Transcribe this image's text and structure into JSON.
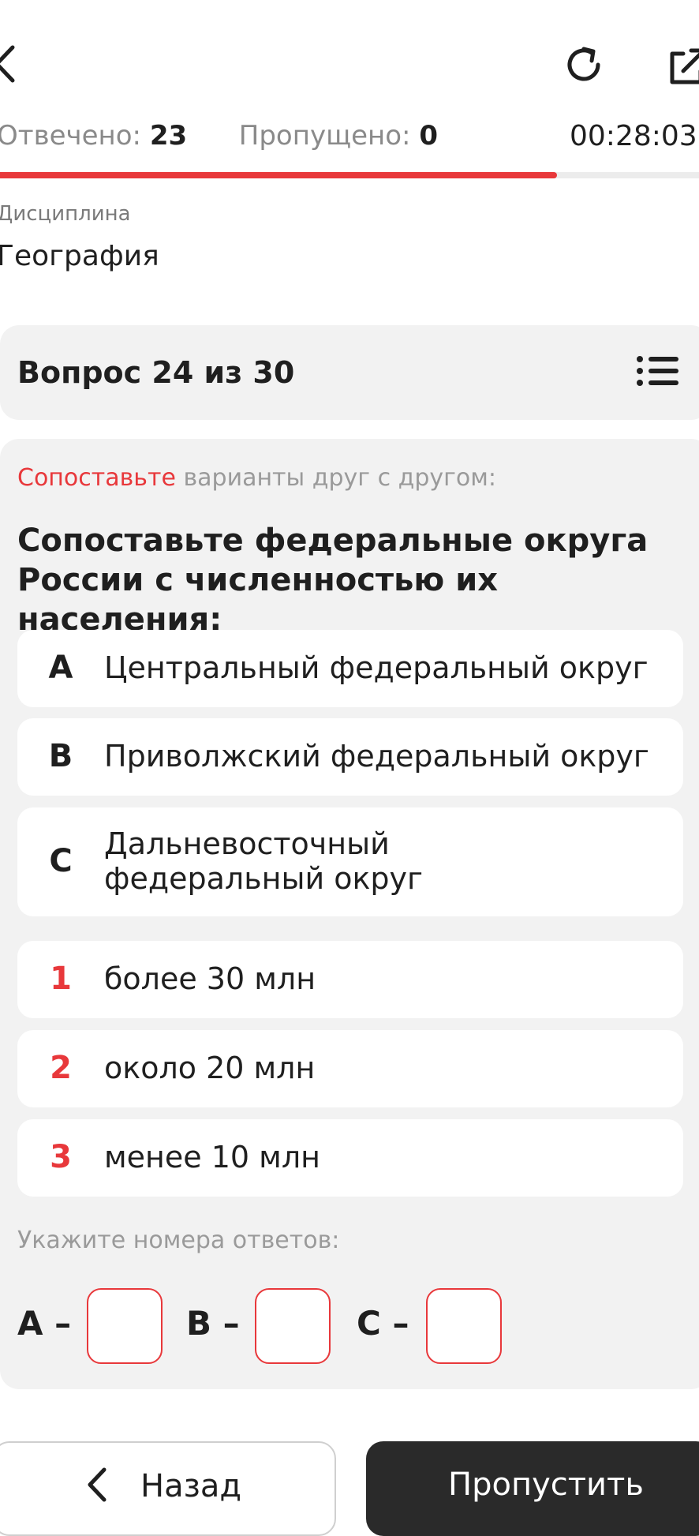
{
  "header": {
    "answered_label": "Отвечено:",
    "answered_value": "23",
    "skipped_label": "Пропущено:",
    "skipped_value": "0",
    "timer": "00:28:03",
    "progress_fraction": 0.7967
  },
  "discipline": {
    "label": "Дисциплина",
    "value": "География"
  },
  "question_header": {
    "title": "Вопрос 24 из 30"
  },
  "question": {
    "instruction_highlight": "Сопоставьте",
    "instruction_rest": " варианты друг с другом:",
    "text": "Сопоставьте федеральные округа России с численностью их населения:",
    "left_options": [
      {
        "key": "A",
        "text": "Центральный федеральный округ"
      },
      {
        "key": "B",
        "text": "Приволжский федеральный округ"
      },
      {
        "key": "C",
        "text": "Дальневосточный федеральный округ"
      }
    ],
    "right_options": [
      {
        "key": "1",
        "text": "более 30 млн"
      },
      {
        "key": "2",
        "text": "около 20 млн"
      },
      {
        "key": "3",
        "text": "менее 10 млн"
      }
    ],
    "answer_hint": "Укажите номера ответов:",
    "answer_labels": [
      "A –",
      "B –",
      "C –"
    ],
    "answer_values": [
      "",
      "",
      ""
    ]
  },
  "buttons": {
    "back_label": "Назад",
    "skip_label": "Пропустить"
  },
  "colors": {
    "accent": "#e8383b",
    "card_bg": "#f2f2f2",
    "dark_button": "#2a2a2a"
  }
}
